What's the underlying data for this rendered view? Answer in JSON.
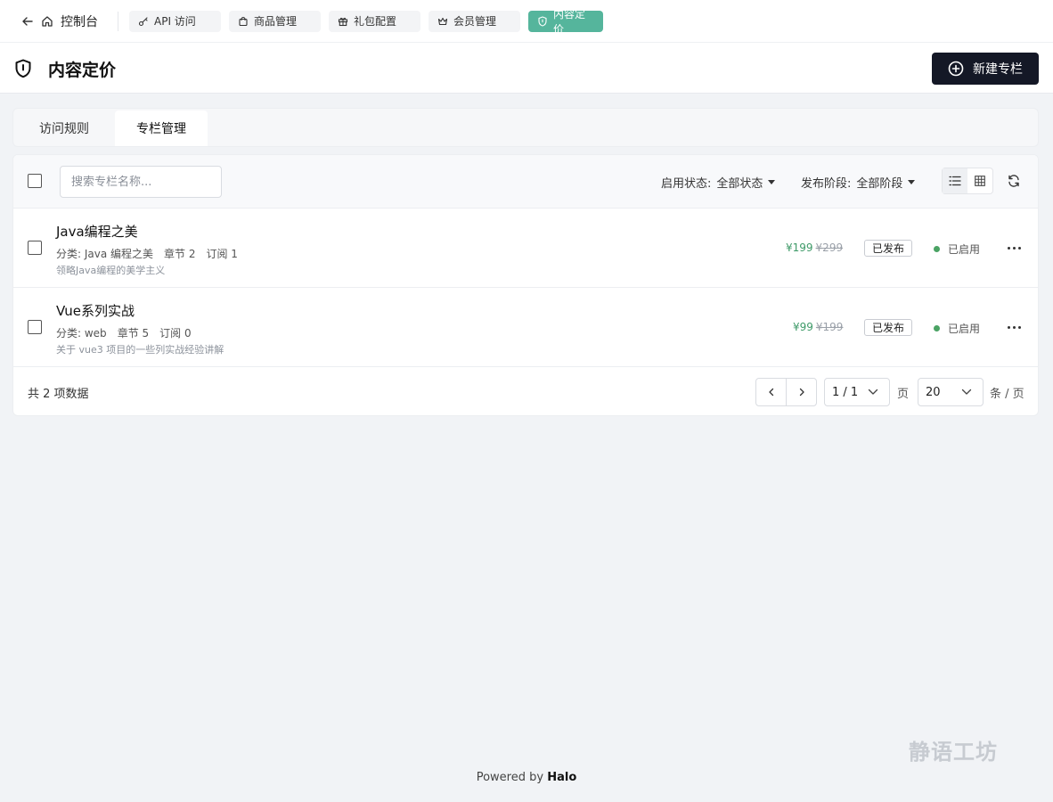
{
  "nav": {
    "back_label": "控制台",
    "tabs": [
      {
        "label": "API 访问",
        "icon": "key-icon"
      },
      {
        "label": "商品管理",
        "icon": "shopping-bag-icon"
      },
      {
        "label": "礼包配置",
        "icon": "gift-icon"
      },
      {
        "label": "会员管理",
        "icon": "crown-icon"
      },
      {
        "label": "内容定价",
        "icon": "shield-icon",
        "active": true
      }
    ]
  },
  "header": {
    "title": "内容定价",
    "new_button": "新建专栏"
  },
  "tabs": [
    "访问规则",
    "专栏管理"
  ],
  "toolbar": {
    "search_placeholder": "搜索专栏名称...",
    "filter_status_label": "启用状态:",
    "filter_status_value": "全部状态",
    "filter_stage_label": "发布阶段:",
    "filter_stage_value": "全部阶段"
  },
  "rows": [
    {
      "name": "Java编程之美",
      "category": "分类: Java 编程之美",
      "chapters": "章节 2",
      "subscriptions": "订阅 1",
      "description": "领略Java编程的美学主义",
      "price_now": "¥199",
      "price_old": "¥299",
      "publish_badge": "已发布",
      "status": "已启用"
    },
    {
      "name": "Vue系列实战",
      "category": "分类: web",
      "chapters": "章节 5",
      "subscriptions": "订阅 0",
      "description": "关于 vue3 项目的一些列实战经验讲解",
      "price_now": "¥99",
      "price_old": "¥199",
      "publish_badge": "已发布",
      "status": "已启用"
    }
  ],
  "pagination": {
    "total": "共 2 项数据",
    "page": "1 / 1",
    "page_unit": "页",
    "page_size": "20",
    "page_size_unit": "条 / 页"
  },
  "watermark": "静语工坊",
  "footer": {
    "powered_prefix": "Powered by",
    "powered_brand": "Halo"
  },
  "colors": {
    "accent": "#55b59c",
    "primary_button": "#141826",
    "price_green": "#3e9a68",
    "status_dot": "#4aa364"
  }
}
